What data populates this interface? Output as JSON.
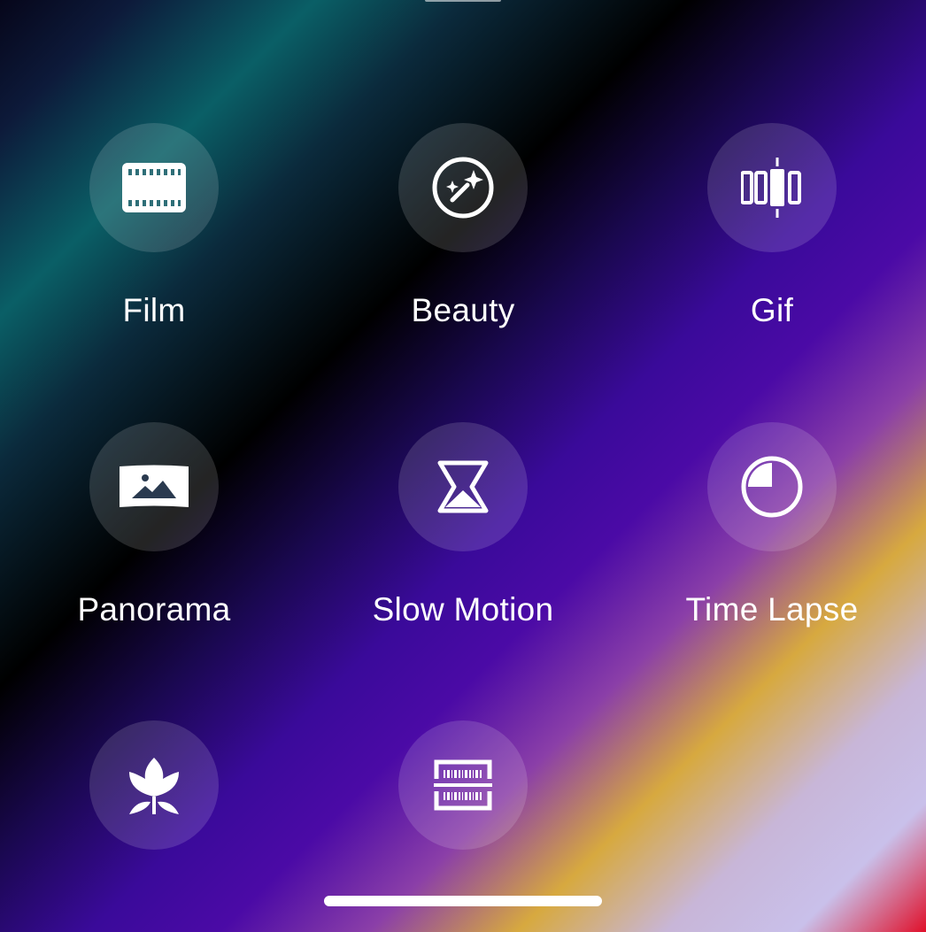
{
  "modes": [
    {
      "label": "Film",
      "icon": "film-icon"
    },
    {
      "label": "Beauty",
      "icon": "beauty-wand-icon"
    },
    {
      "label": "Gif",
      "icon": "gif-frames-icon"
    },
    {
      "label": "Panorama",
      "icon": "panorama-icon"
    },
    {
      "label": "Slow Motion",
      "icon": "hourglass-icon"
    },
    {
      "label": "Time Lapse",
      "icon": "time-lapse-icon"
    },
    {
      "label": "",
      "icon": "macro-flower-icon"
    },
    {
      "label": "",
      "icon": "barcode-scan-icon"
    }
  ],
  "colors": {
    "icon": "#ffffff",
    "circle_bg": "rgba(255,255,255,0.14)"
  }
}
